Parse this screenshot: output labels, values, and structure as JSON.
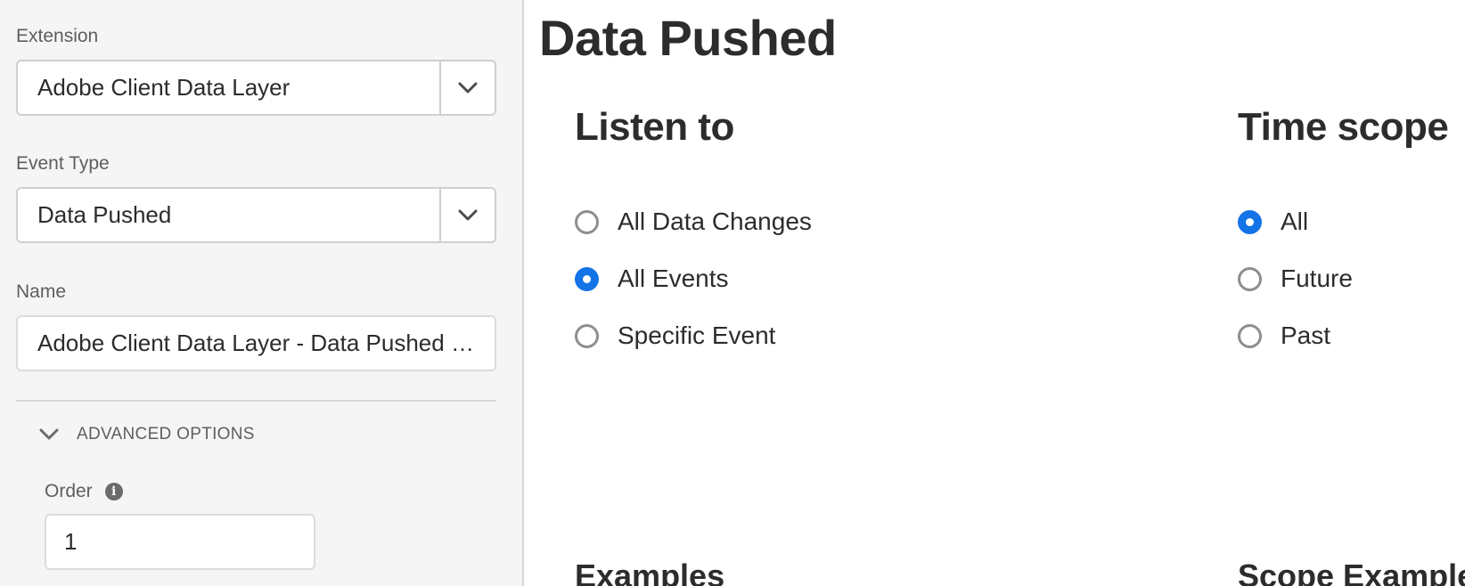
{
  "sidebar": {
    "extension": {
      "label": "Extension",
      "value": "Adobe Client Data Layer"
    },
    "event_type": {
      "label": "Event Type",
      "value": "Data Pushed"
    },
    "name": {
      "label": "Name",
      "value": "Adobe Client Data Layer - Data Pushed all events"
    },
    "advanced_options": {
      "label": "ADVANCED OPTIONS",
      "expanded": true
    },
    "order": {
      "label": "Order",
      "value": "1"
    }
  },
  "main": {
    "title": "Data Pushed",
    "listen_to": {
      "heading": "Listen to",
      "options": [
        {
          "label": "All Data Changes",
          "checked": false
        },
        {
          "label": "All Events",
          "checked": true
        },
        {
          "label": "Specific Event",
          "checked": false
        }
      ]
    },
    "time_scope": {
      "heading": "Time scope",
      "options": [
        {
          "label": "All",
          "checked": true
        },
        {
          "label": "Future",
          "checked": false
        },
        {
          "label": "Past",
          "checked": false
        }
      ]
    },
    "examples_heading": "Examples",
    "scope_examples_heading": "Scope Examples"
  },
  "colors": {
    "accent": "#1473e6",
    "panel_bg": "#f5f5f5"
  }
}
